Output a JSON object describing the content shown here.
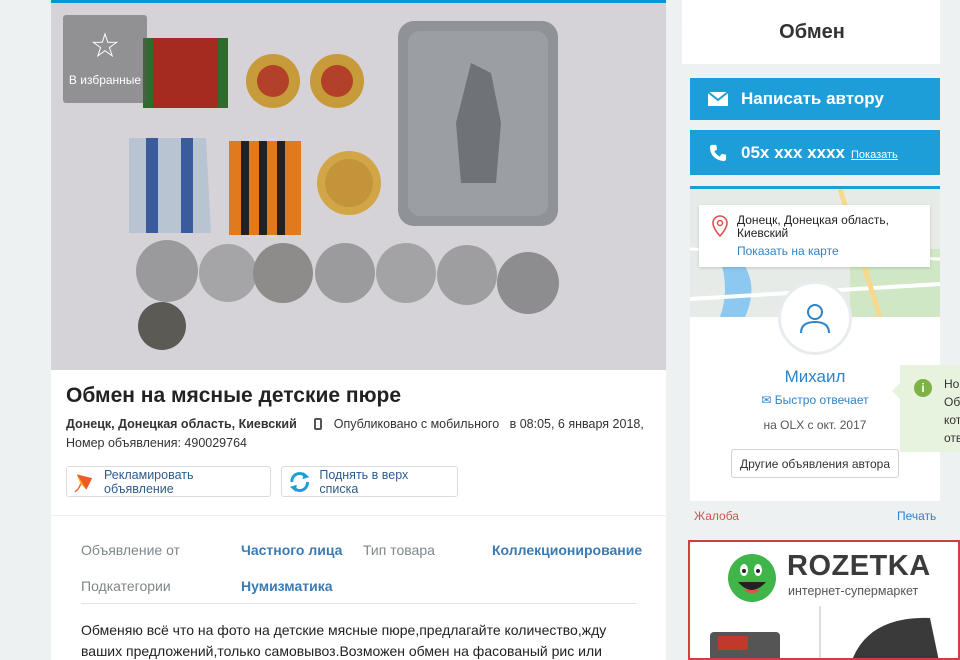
{
  "favorite": {
    "label": "В избранные"
  },
  "ad": {
    "title": "Обмен на мясные детские пюре",
    "location": "Донецк, Донецкая область, Киевский",
    "published_via": "Опубликовано с мобильного",
    "published_at": "в 08:05, 6 января 2018,",
    "ad_number": "Номер объявления: 490029764",
    "promote_label": "Рекламировать объявление",
    "raise_label": "Поднять в верх списка"
  },
  "attributes": [
    {
      "label": "Объявление от",
      "value": "Частного лица"
    },
    {
      "label": "Тип товара",
      "value": "Коллекционирование"
    },
    {
      "label": "Подкатегории",
      "value": "Нумизматика"
    }
  ],
  "description": "Обменяю всё что на фото на детские мясные пюре,предлагайте количество,жду ваших предложений,только самовывоз.Возможен обмен на фасованый рис или",
  "sidebar": {
    "exchange_label": "Обмен",
    "message_label": "Написать автору",
    "phone": "05x xxx xxxx",
    "show_label": "Показать",
    "address": "Донецк, Донецкая область, Киевский",
    "show_on_map": "Показать на карте",
    "seller_name": "Михаил",
    "fast_reply": "Быстро отвечает",
    "on_olx_since": "на OLX с окт. 2017",
    "other_ads": "Другие объявления автора",
    "complain": "Жалоба",
    "print": "Печать"
  },
  "banner": {
    "brand": "ROZETKA",
    "tagline": "интернет-супермаркет"
  },
  "notice": {
    "lines": [
      "Но",
      "Об",
      "кот",
      "отв"
    ]
  },
  "colors": {
    "accent_blue": "#1d9ed9",
    "link_blue": "#2f83c7",
    "complain_red": "#c65b4e",
    "banner_border": "#d13e3e",
    "notice_green": "#7cb342"
  }
}
